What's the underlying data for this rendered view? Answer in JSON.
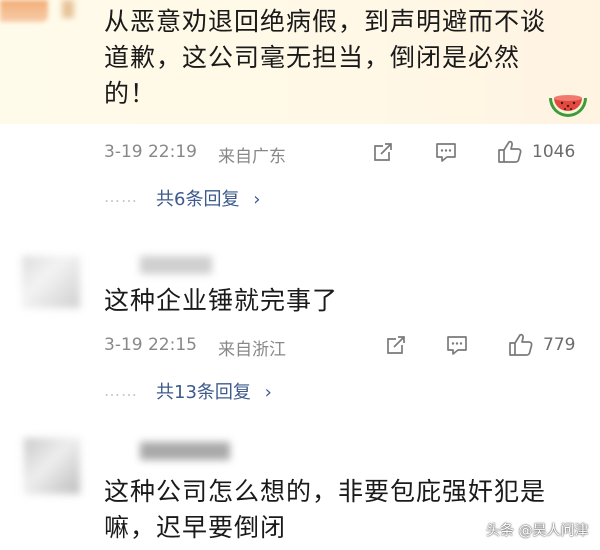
{
  "comments": [
    {
      "text_lines": [
        "从恶意劝退回绝病假，到声明避而不谈",
        "道歉，这公司毫无担当，倒闭是必然",
        "的！"
      ],
      "time": "3-19 22:19",
      "location": "来自广东",
      "likes": "1046",
      "replies": "共6条回复",
      "badge_icon": "watermelon-icon"
    },
    {
      "text_lines": [
        "这种企业锤就完事了"
      ],
      "time": "3-19 22:15",
      "location": "来自浙江",
      "likes": "779",
      "replies": "共13条回复"
    },
    {
      "text_lines": [
        "这种公司怎么想的，非要包庇强奸犯是",
        "嘛，迟早要倒闭"
      ]
    }
  ],
  "watermark": "头条 @昊人问津",
  "colors": {
    "link": "#3d5a8c",
    "meta": "#888888",
    "highlight_bg": "#fff8e6"
  }
}
